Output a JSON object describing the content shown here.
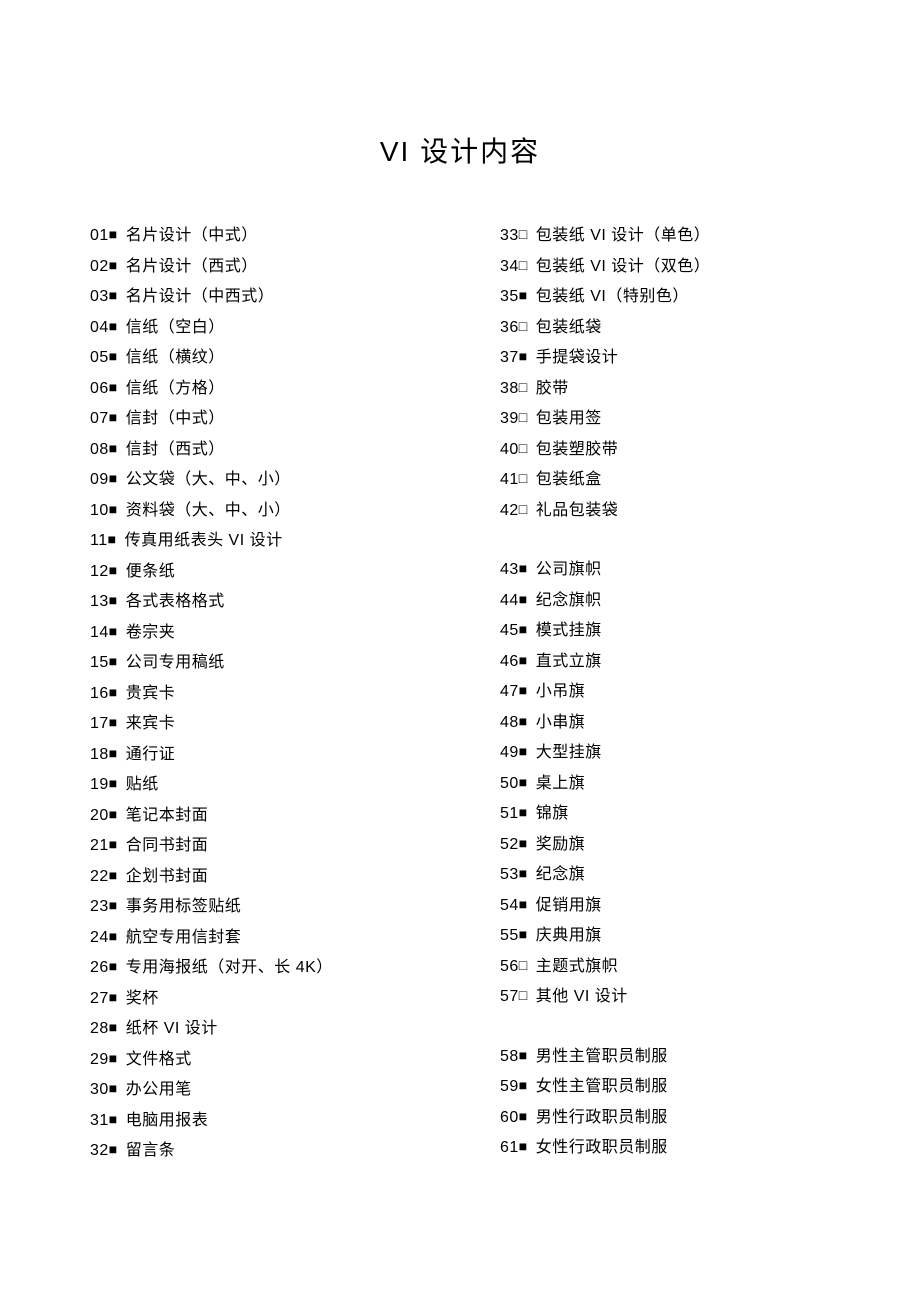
{
  "title": "VI 设计内容",
  "leftColumn": [
    {
      "num": "01",
      "mark": "■",
      "label": "名片设计（中式）"
    },
    {
      "num": "02",
      "mark": "■",
      "label": "名片设计（西式）"
    },
    {
      "num": "03",
      "mark": "■",
      "label": "名片设计（中西式）"
    },
    {
      "num": "04",
      "mark": "■",
      "label": "信纸（空白）"
    },
    {
      "num": "05",
      "mark": "■",
      "label": "信纸（横纹）"
    },
    {
      "num": "06",
      "mark": "■",
      "label": "信纸（方格）"
    },
    {
      "num": "07",
      "mark": "■",
      "label": "信封（中式）"
    },
    {
      "num": "08",
      "mark": "■",
      "label": "信封（西式）"
    },
    {
      "num": "09",
      "mark": "■",
      "label": "公文袋（大、中、小）"
    },
    {
      "num": "10",
      "mark": "■",
      "label": "资料袋（大、中、小）"
    },
    {
      "num": "11",
      "mark": "■",
      "label": "传真用纸表头 VI 设计"
    },
    {
      "num": "12",
      "mark": "■",
      "label": "便条纸"
    },
    {
      "num": "13",
      "mark": "■",
      "label": "各式表格格式"
    },
    {
      "num": "14",
      "mark": "■",
      "label": "卷宗夹"
    },
    {
      "num": "15",
      "mark": "■",
      "label": "公司专用稿纸"
    },
    {
      "num": "16",
      "mark": "■",
      "label": "贵宾卡"
    },
    {
      "num": "17",
      "mark": "■",
      "label": "来宾卡"
    },
    {
      "num": "18",
      "mark": "■",
      "label": "通行证"
    },
    {
      "num": "19",
      "mark": "■",
      "label": "贴纸"
    },
    {
      "num": "20",
      "mark": "■",
      "label": "笔记本封面"
    },
    {
      "num": "21",
      "mark": "■",
      "label": "合同书封面"
    },
    {
      "num": "22",
      "mark": "■",
      "label": "企划书封面"
    },
    {
      "num": "23",
      "mark": "■",
      "label": "事务用标签贴纸"
    },
    {
      "num": "24",
      "mark": "■",
      "label": "航空专用信封套"
    },
    {
      "num": "26",
      "mark": "■",
      "label": "专用海报纸（对开、长 4K）"
    },
    {
      "num": "27",
      "mark": "■",
      "label": "奖杯"
    },
    {
      "num": "28",
      "mark": "■",
      "label": "纸杯 VI 设计"
    },
    {
      "num": "29",
      "mark": "■",
      "label": "文件格式"
    },
    {
      "num": "30",
      "mark": "■",
      "label": "办公用笔"
    },
    {
      "num": "31",
      "mark": "■",
      "label": "电脑用报表"
    },
    {
      "num": "32",
      "mark": "■",
      "label": "留言条"
    }
  ],
  "rightColumn": [
    {
      "num": "33",
      "mark": "□",
      "label": "包装纸 VI 设计（单色）"
    },
    {
      "num": "34",
      "mark": "□",
      "label": "包装纸 VI 设计（双色）"
    },
    {
      "num": "35",
      "mark": "■",
      "label": "包装纸 VI（特别色）"
    },
    {
      "num": "36",
      "mark": "□",
      "label": "包装纸袋"
    },
    {
      "num": "37",
      "mark": "■",
      "label": "手提袋设计"
    },
    {
      "num": "38",
      "mark": "□",
      "label": "胶带"
    },
    {
      "num": "39",
      "mark": "□",
      "label": "包装用签"
    },
    {
      "num": "40",
      "mark": "□",
      "label": "包装塑胶带"
    },
    {
      "num": "41",
      "mark": "□",
      "label": "包装纸盒"
    },
    {
      "num": "42",
      "mark": "□",
      "label": "礼品包装袋"
    },
    {
      "gap": true
    },
    {
      "num": "43",
      "mark": "■",
      "label": "公司旗帜"
    },
    {
      "num": "44",
      "mark": "■",
      "label": "纪念旗帜"
    },
    {
      "num": "45",
      "mark": "■",
      "label": "模式挂旗"
    },
    {
      "num": "46",
      "mark": "■",
      "label": "直式立旗"
    },
    {
      "num": "47",
      "mark": "■",
      "label": "小吊旗"
    },
    {
      "num": "48",
      "mark": "■",
      "label": "小串旗"
    },
    {
      "num": "49",
      "mark": "■",
      "label": "大型挂旗"
    },
    {
      "num": "50",
      "mark": "■",
      "label": "桌上旗"
    },
    {
      "num": "51",
      "mark": "■",
      "label": "锦旗"
    },
    {
      "num": "52",
      "mark": "■",
      "label": "奖励旗"
    },
    {
      "num": "53",
      "mark": "■",
      "label": "纪念旗"
    },
    {
      "num": "54",
      "mark": "■",
      "label": "促销用旗"
    },
    {
      "num": "55",
      "mark": "■",
      "label": "庆典用旗"
    },
    {
      "num": "56",
      "mark": "□",
      "label": "主题式旗帜"
    },
    {
      "num": "57",
      "mark": "□",
      "label": "其他 VI 设计"
    },
    {
      "gap": true
    },
    {
      "num": "58",
      "mark": "■",
      "label": "男性主管职员制服"
    },
    {
      "num": "59",
      "mark": "■",
      "label": "女性主管职员制服"
    },
    {
      "num": "60",
      "mark": "■",
      "label": "男性行政职员制服"
    },
    {
      "num": "61",
      "mark": "■",
      "label": "女性行政职员制服"
    }
  ]
}
